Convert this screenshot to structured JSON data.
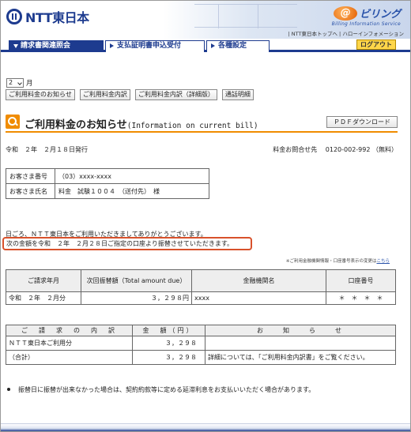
{
  "header": {
    "ntt_logo_text": "NTT東日本",
    "billing_mark": "@",
    "billing_name": "ビリング",
    "billing_sub": "Billing Information Service",
    "top_links": "| NTT東日本トップへ | ハローインフォメーション"
  },
  "nav": {
    "tabs": [
      {
        "label": "請求書関連照会",
        "active": true
      },
      {
        "label": "支払証明書申込受付",
        "active": false
      },
      {
        "label": "各種設定",
        "active": false
      }
    ],
    "logout_label": "ログアウト"
  },
  "controls": {
    "month_value": "2",
    "month_suffix": "月",
    "buttons": [
      "ご利用料金のお知らせ",
      "ご利用料金内訳",
      "ご利用料金内訳（詳細版）",
      "通話明細"
    ]
  },
  "page": {
    "title": "ご利用料金のお知らせ",
    "title_en": "(Information on current bill)",
    "pdf_button": "ＰＤＦダウンロード",
    "issue_date": "令和　２年　２月１８日発行",
    "contact": "料金お問合せ先　 0120-002-992 （無料）"
  },
  "customer": {
    "number_label": "お客さま番号",
    "number_value": "（03）xxxx-xxxx",
    "name_label": "お客さま氏名",
    "name_value": "料金　試験１００４　（送付先）　様"
  },
  "messages": {
    "greeting": "日ごろ、ＮＴＴ東日本をご利用いただきましてありがとうございます。",
    "notice": "次の金額を令和　２年　２月２８日ご指定の口座より振替させていただきます。",
    "side_note": "※ご利用金融機関情報・口座番号表示の変更は",
    "side_note_link": "こちら"
  },
  "payment": {
    "headers": [
      "ご請求年月",
      "次回振替額（Total amount due）",
      "金融機関名",
      "口座番号"
    ],
    "row": [
      "令和　２年　２月分",
      "３，２９８円",
      "xxxx",
      "＊　＊　＊　＊"
    ]
  },
  "detail": {
    "headers": [
      "ご　請　求　の　内　訳",
      "金　額（円）",
      "お　　知　　ら　　せ"
    ],
    "rows": [
      [
        "ＮＴＴ東日本ご利用分",
        "３，２９８",
        ""
      ],
      [
        "（合計）",
        "３，２９８",
        "詳細については、「ご利用料金内訳書」をご覧ください。"
      ]
    ]
  },
  "footnote": "振替日に振替が出来なかった場合は、契約約款等に定める延滞利息をお支払いいただく場合があります。",
  "colors": {
    "brand": "#1d3b8f",
    "accent": "#f08c00",
    "highlight": "#d8512b"
  }
}
